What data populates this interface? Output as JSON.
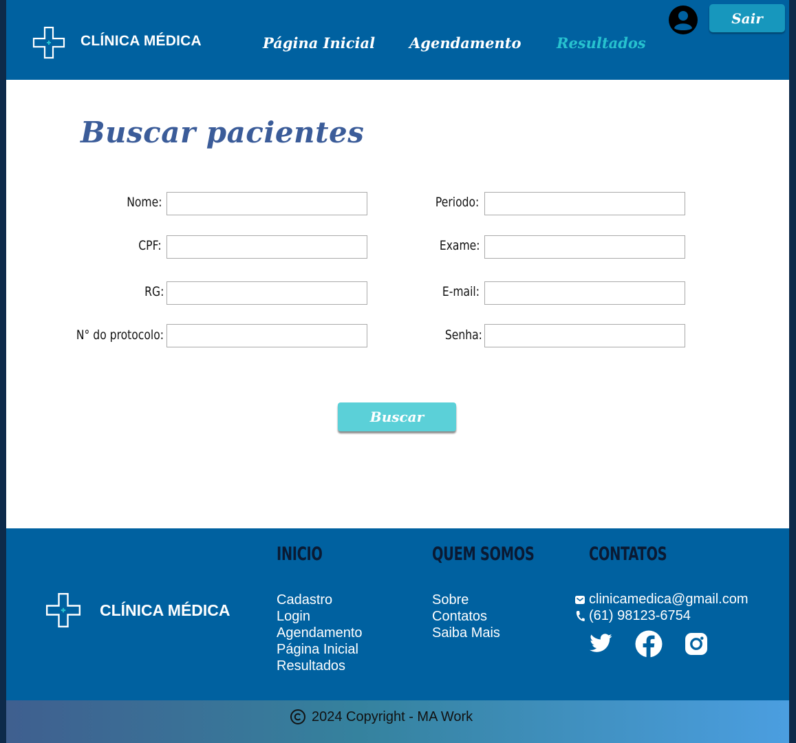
{
  "header": {
    "brand": "CLÍNICA MÉDICA",
    "nav": [
      "Página Inicial",
      "Agendamento",
      "Resultados"
    ],
    "active_nav": "Resultados",
    "logout_label": "Sair",
    "icons": [
      "medical-cross-logo",
      "user-avatar-icon"
    ]
  },
  "main": {
    "title": "Buscar pacientes",
    "left_fields": [
      {
        "label": "Nome:",
        "value": ""
      },
      {
        "label": "CPF:",
        "value": ""
      },
      {
        "label": "RG:",
        "value": ""
      },
      {
        "label": "N° do protocolo:",
        "value": ""
      }
    ],
    "right_fields": [
      {
        "label": "Periodo:",
        "value": ""
      },
      {
        "label": "Exame:",
        "value": ""
      },
      {
        "label": "E-mail:",
        "value": ""
      },
      {
        "label": "Senha:",
        "value": ""
      }
    ],
    "search_button": "Buscar"
  },
  "footer": {
    "brand": "CLÍNICA MÉDICA",
    "columns": [
      {
        "heading": "INICIO",
        "links": [
          "Cadastro",
          "Login",
          "Agendamento",
          "Página Inicial",
          "Resultados"
        ]
      },
      {
        "heading": "QUEM SOMOS",
        "links": [
          "Sobre",
          "Contatos",
          "Saiba Mais"
        ]
      },
      {
        "heading": "CONTATOS",
        "links": []
      }
    ],
    "email": "clinicamedica@gmail.com",
    "phone": "(61) 98123-6754",
    "social": [
      "twitter-icon",
      "facebook-icon",
      "instagram-icon"
    ],
    "copyright": "2024 Copyright - MA Work"
  },
  "colors": {
    "header_bg": "#0061a0",
    "active_nav": "#27c2cf",
    "title": "#3b5c99",
    "buscar_button": "#5bd0d8",
    "sair_button": "#1797bd",
    "footer_heading": "#0a1a33"
  }
}
